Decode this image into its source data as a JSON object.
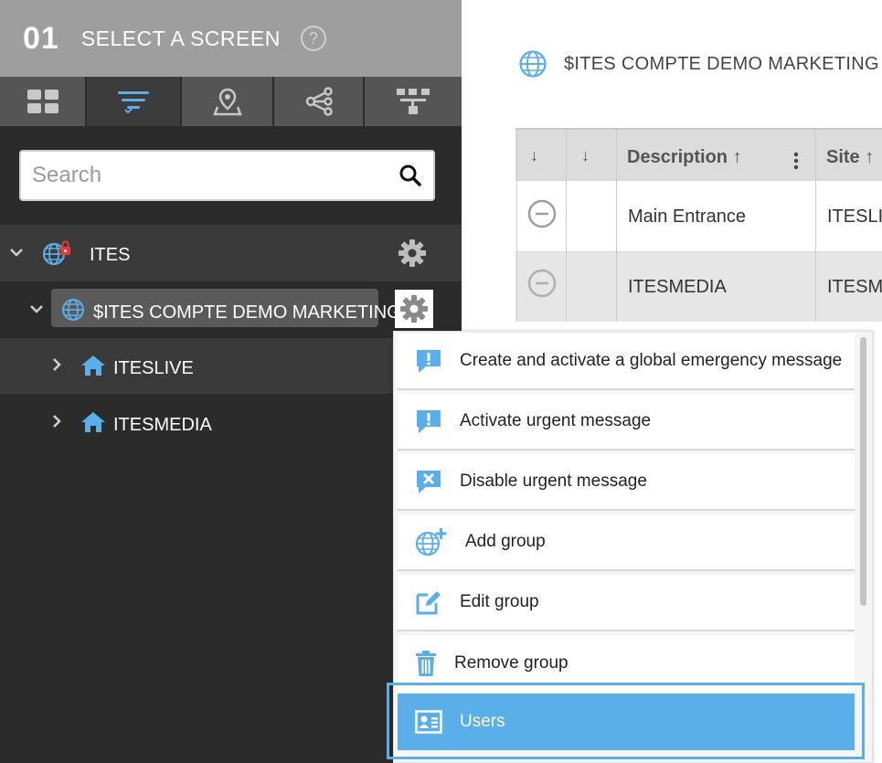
{
  "sidebar": {
    "step_number": "01",
    "title": "SELECT A SCREEN",
    "help_glyph": "?",
    "tabs": [
      {
        "icon": "dashboard-grid-icon",
        "active": false
      },
      {
        "icon": "filter-list-icon",
        "active": true
      },
      {
        "icon": "map-pin-icon",
        "active": false
      },
      {
        "icon": "share-nodes-icon",
        "active": false
      },
      {
        "icon": "hierarchy-icon",
        "active": false
      }
    ],
    "search": {
      "placeholder": "Search",
      "value": ""
    },
    "tree": [
      {
        "label": "ITES",
        "icon": "globe-lock-icon",
        "expanded": true
      },
      {
        "label": "$ITES COMPTE DEMO MARKETING",
        "icon": "globe-icon",
        "expanded": true,
        "selected": true
      },
      {
        "label": "ITESLIVE",
        "icon": "home-icon",
        "expanded": false
      },
      {
        "label": "ITESMEDIA",
        "icon": "home-icon",
        "expanded": false
      }
    ]
  },
  "main": {
    "title": "$ITES COMPTE DEMO MARKETING",
    "table": {
      "sort_glyph_1": "↓",
      "sort_glyph_2": "↓",
      "headers": [
        {
          "label": "Description",
          "sort": "↑"
        },
        {
          "label": "Site",
          "sort": "↑"
        }
      ],
      "rows": [
        {
          "description": "Main Entrance",
          "site": "ITESLIV"
        },
        {
          "description": "ITESMEDIA",
          "site": "ITESME"
        }
      ]
    }
  },
  "menu": {
    "items": [
      {
        "label": "Create and activate a global emergency message",
        "icon": "alert-message-icon"
      },
      {
        "label": "Activate urgent message",
        "icon": "alert-message-icon"
      },
      {
        "label": "Disable urgent message",
        "icon": "disable-message-icon"
      },
      {
        "label": "Add group",
        "icon": "globe-add-icon"
      },
      {
        "label": "Edit group",
        "icon": "edit-icon"
      },
      {
        "label": "Remove group",
        "icon": "trash-icon"
      },
      {
        "label": "Users",
        "icon": "user-card-icon",
        "selected": true
      }
    ]
  },
  "colors": {
    "accent": "#5aaeea",
    "sidebar_bg": "#2b2b2b",
    "header_bg": "#9e9e9e"
  }
}
